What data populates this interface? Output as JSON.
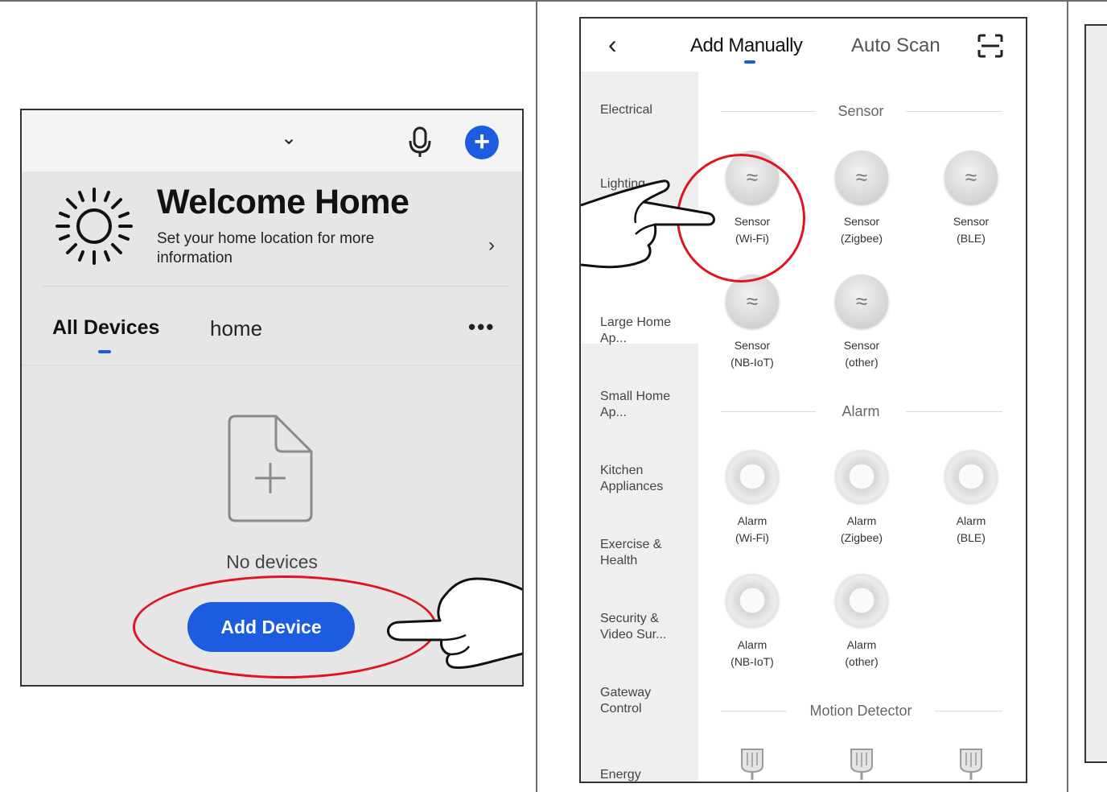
{
  "panel1": {
    "welcome_title": "Welcome Home",
    "welcome_subtitle": "Set your home location for more information",
    "tabs": [
      {
        "label": "All Devices",
        "active": true
      },
      {
        "label": "home",
        "active": false
      }
    ],
    "empty_text": "No devices",
    "add_button": "Add Device",
    "icons": [
      "chevron-down-icon",
      "microphone-icon",
      "plus-icon",
      "sun-icon",
      "chevron-right-icon",
      "more-icon",
      "document-add-icon",
      "pointing-hand-icon"
    ],
    "accent_color": "#1d5be0",
    "highlight_color": "#e0141e"
  },
  "panel2": {
    "tabs": [
      {
        "label": "Add Manually",
        "active": true
      },
      {
        "label": "Auto Scan",
        "active": false
      }
    ],
    "sidebar": [
      {
        "label": "Electrical"
      },
      {
        "label": "Lighting"
      },
      {
        "label": "Large Home Ap..."
      },
      {
        "label": "Small Home Ap..."
      },
      {
        "label": "Kitchen Appliances"
      },
      {
        "label": "Exercise & Health"
      },
      {
        "label": "Security & Video Sur..."
      },
      {
        "label": "Gateway Control"
      },
      {
        "label": "Energy"
      }
    ],
    "sections": [
      {
        "title": "Sensor",
        "devices": [
          {
            "line1": "Sensor",
            "line2": "(Wi-Fi)"
          },
          {
            "line1": "Sensor",
            "line2": "(Zigbee)"
          },
          {
            "line1": "Sensor",
            "line2": "(BLE)"
          },
          {
            "line1": "Sensor",
            "line2": "(NB-IoT)"
          },
          {
            "line1": "Sensor",
            "line2": "(other)"
          }
        ]
      },
      {
        "title": "Alarm",
        "devices": [
          {
            "line1": "Alarm",
            "line2": "(Wi-Fi)"
          },
          {
            "line1": "Alarm",
            "line2": "(Zigbee)"
          },
          {
            "line1": "Alarm",
            "line2": "(BLE)"
          },
          {
            "line1": "Alarm",
            "line2": "(NB-IoT)"
          },
          {
            "line1": "Alarm",
            "line2": "(other)"
          }
        ]
      },
      {
        "title": "Motion Detector"
      }
    ],
    "icons": [
      "back-arrow-icon",
      "scan-icon",
      "sensor-icon",
      "alarm-icon",
      "motion-detector-icon",
      "pointing-hand-icon"
    ],
    "accent_color": "#1d5be0",
    "highlight_color": "#e0141e"
  }
}
